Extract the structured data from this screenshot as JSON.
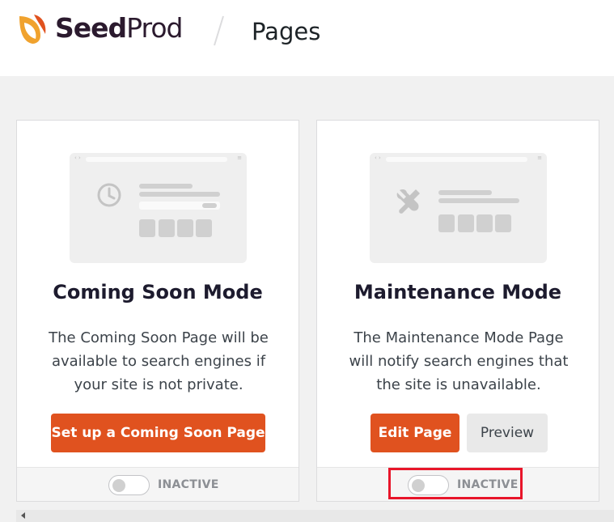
{
  "header": {
    "brand_bold": "Seed",
    "brand_thin": "Prod",
    "separator": "/",
    "title": "Pages",
    "logo_colors": [
      "#f0a22e",
      "#e0521f"
    ]
  },
  "cards": [
    {
      "title": "Coming Soon Mode",
      "description": "The Coming Soon Page will be available to search engines if your site is not private.",
      "illustration_icon": "clock-icon",
      "primary_button": "Set up a Coming Soon Page",
      "status": "INACTIVE",
      "toggle_on": false
    },
    {
      "title": "Maintenance Mode",
      "description": "The Maintenance Mode Page will notify search engines that the site is unavailable.",
      "illustration_icon": "wrench-icon",
      "primary_button": "Edit Page",
      "secondary_button": "Preview",
      "status": "INACTIVE",
      "toggle_on": false
    }
  ],
  "colors": {
    "accent": "#e0521f",
    "highlight": "#e8152a"
  }
}
